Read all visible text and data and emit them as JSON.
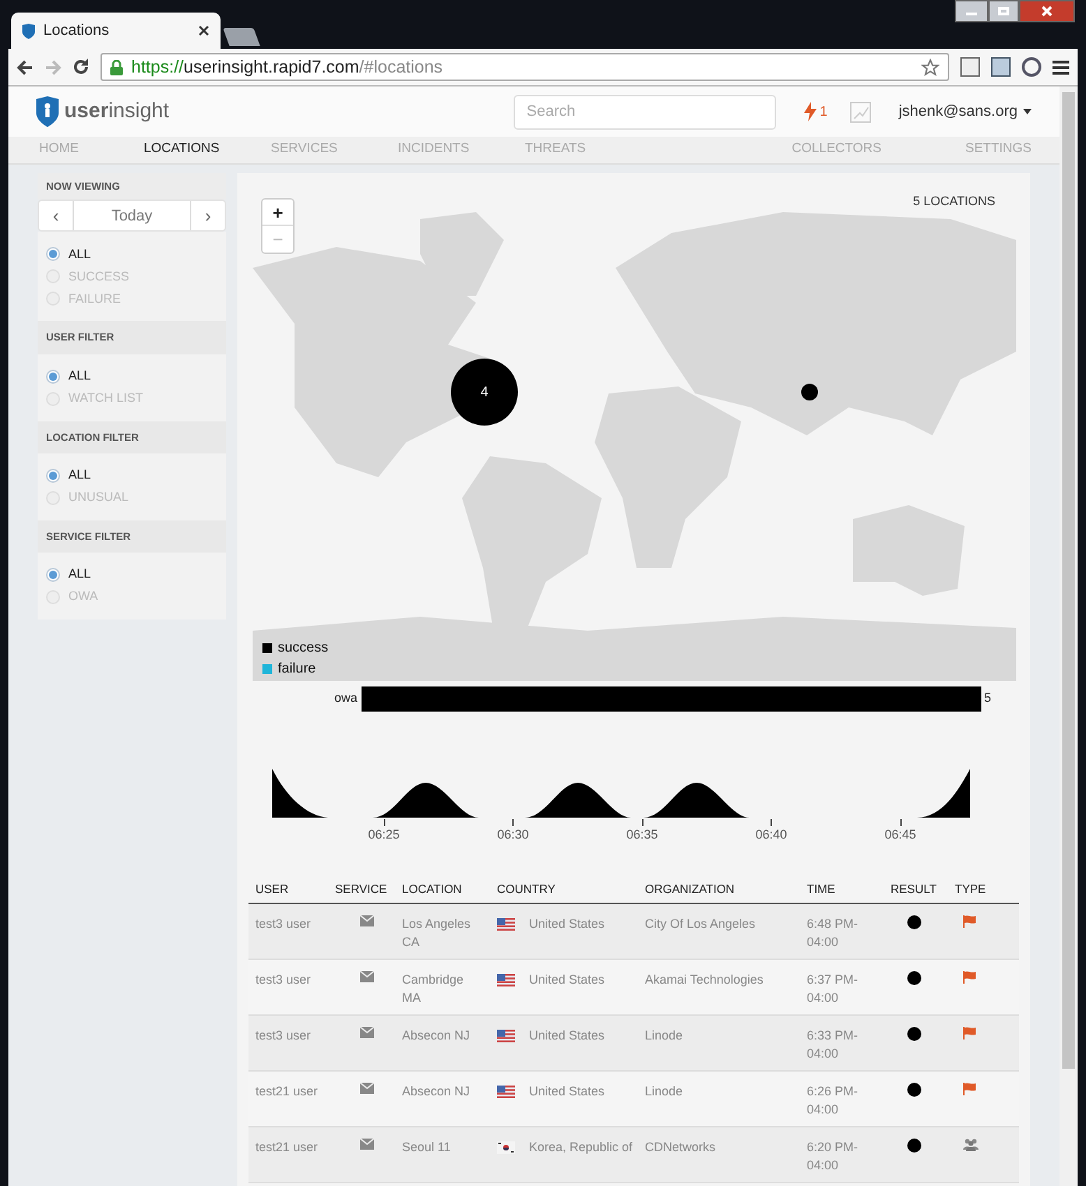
{
  "browser": {
    "tab_title": "Locations",
    "url": {
      "scheme": "https://",
      "host": "userinsight.rapid7.com",
      "path": "/#locations"
    }
  },
  "header": {
    "logo": "**user**insight",
    "search": {
      "placeholder": "Search"
    },
    "alerts": "1",
    "user": "jshenk@sans.org"
  },
  "nav": [
    {
      "label": "HOME",
      "selected": false
    },
    {
      "label": "LOCATIONS",
      "selected": true
    },
    {
      "label": "SERVICES",
      "selected": false
    },
    {
      "label": "INCIDENTS",
      "selected": false
    },
    {
      "label": "THREATS",
      "selected": false
    },
    {
      "label": "COLLECTORS",
      "selected": false
    },
    {
      "label": "SETTINGS",
      "selected": false
    }
  ],
  "sidebar": {
    "now_viewing": {
      "title": "NOW VIEWING",
      "prev": "‹",
      "period": "Today",
      "next": "›"
    },
    "sections": [
      {
        "options": [
          {
            "label": "ALL",
            "selected": true
          },
          {
            "label": "SUCCESS",
            "selected": false
          },
          {
            "label": "FAILURE",
            "selected": false
          }
        ]
      },
      {
        "title": "USER FILTER",
        "options": [
          {
            "label": "ALL",
            "selected": true
          },
          {
            "label": "WATCH LIST",
            "selected": false
          }
        ]
      },
      {
        "title": "LOCATION FILTER",
        "options": [
          {
            "label": "ALL",
            "selected": true
          },
          {
            "label": "UNUSUAL",
            "selected": false
          }
        ]
      },
      {
        "title": "SERVICE FILTER",
        "options": [
          {
            "label": "ALL",
            "selected": true
          },
          {
            "label": "OWA",
            "selected": false
          }
        ]
      }
    ]
  },
  "map": {
    "count": "5 LOCATIONS",
    "zoom_in": "+",
    "zoom_out": "−",
    "markers": [
      {
        "kind": "cluster",
        "label": "4"
      },
      {
        "kind": "point"
      }
    ],
    "legend": [
      {
        "label": "success",
        "color": "#000000"
      },
      {
        "label": "failure",
        "color": "#1fb5d9"
      }
    ]
  },
  "service_chart": {
    "chart_data": {
      "type": "bar",
      "orientation": "horizontal",
      "categories": [
        "owa"
      ],
      "values": [
        5
      ],
      "data_labels": true
    }
  },
  "timeline": {
    "ticks": [
      "06:25",
      "06:30",
      "06:35",
      "06:40",
      "06:45"
    ]
  },
  "table": {
    "columns": [
      "USER",
      "SERVICE",
      "LOCATION",
      "COUNTRY",
      "ORGANIZATION",
      "TIME",
      "RESULT",
      "TYPE"
    ],
    "rows": [
      {
        "user": "test3 user",
        "location": "Los Angeles CA",
        "flag": {
          "kind": "us"
        },
        "country": "United States",
        "organization": "City Of Los Angeles",
        "time": "6:48 PM-04:00",
        "success": true,
        "type": {
          "kind": "flag"
        }
      },
      {
        "user": "test3 user",
        "location": "Cambridge MA",
        "flag": {
          "kind": "us"
        },
        "country": "United States",
        "organization": "Akamai Technologies",
        "time": "6:37 PM-04:00",
        "success": true,
        "type": {
          "kind": "flag"
        }
      },
      {
        "user": "test3 user",
        "location": "Absecon NJ",
        "flag": {
          "kind": "us"
        },
        "country": "United States",
        "organization": "Linode",
        "time": "6:33 PM-04:00",
        "success": true,
        "type": {
          "kind": "flag"
        }
      },
      {
        "user": "test21 user",
        "location": "Absecon NJ",
        "flag": {
          "kind": "us"
        },
        "country": "United States",
        "organization": "Linode",
        "time": "6:26 PM-04:00",
        "success": true,
        "type": {
          "kind": "flag"
        }
      },
      {
        "user": "test21 user",
        "location": "Seoul 11",
        "flag": {
          "kind": "kr"
        },
        "country": "Korea, Republic of",
        "organization": "CDNetworks",
        "time": "6:20 PM-04:00",
        "success": true,
        "type": {
          "kind": "group"
        }
      }
    ]
  }
}
